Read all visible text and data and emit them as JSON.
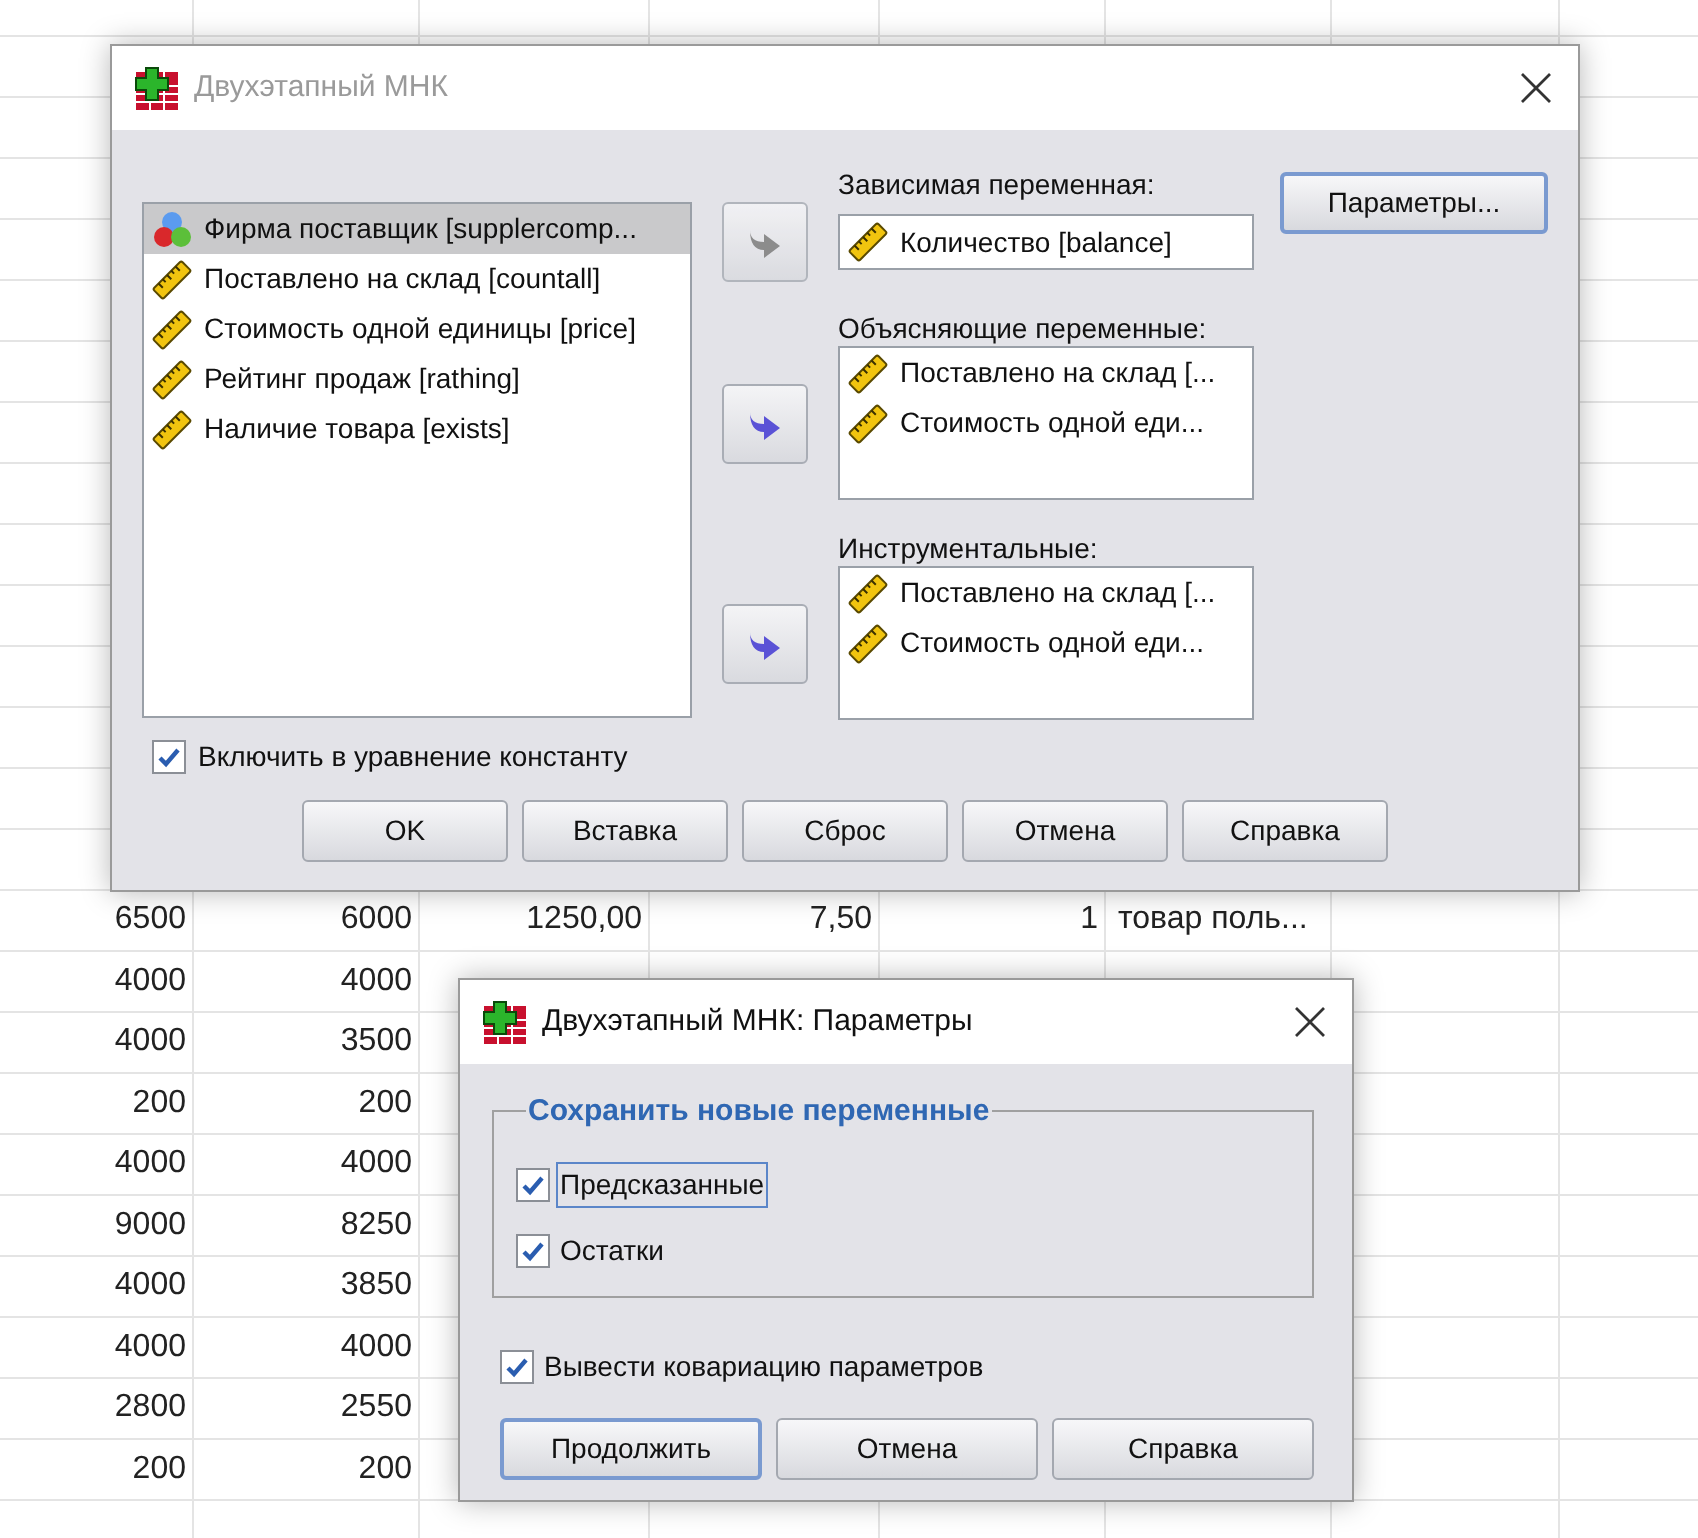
{
  "spreadsheet": {
    "rows": [
      {
        "cells": [
          "6500",
          "6000",
          "1250,00",
          "7,50",
          "1",
          "товар поль..."
        ]
      },
      {
        "cells": [
          "4000",
          "4000"
        ]
      },
      {
        "cells": [
          "4000",
          "3500"
        ]
      },
      {
        "cells": [
          "200",
          "200"
        ]
      },
      {
        "cells": [
          "4000",
          "4000"
        ]
      },
      {
        "cells": [
          "9000",
          "8250"
        ]
      },
      {
        "cells": [
          "4000",
          "3850"
        ]
      },
      {
        "cells": [
          "4000",
          "4000"
        ]
      },
      {
        "cells": [
          "2800",
          "2550"
        ]
      },
      {
        "cells": [
          "200",
          "200"
        ]
      }
    ]
  },
  "main_dialog": {
    "title": "Двухэтапный МНК",
    "active": false,
    "source_list": [
      {
        "label": "Фирма поставщик [supplercomp...",
        "kind": "nominal",
        "selected": true
      },
      {
        "label": "Поставлено на склад [countall]",
        "kind": "scale",
        "selected": false
      },
      {
        "label": "Стоимость одной единицы [price]",
        "kind": "scale",
        "selected": false
      },
      {
        "label": "Рейтинг продаж [rathing]",
        "kind": "scale",
        "selected": false
      },
      {
        "label": "Наличие товара [exists]",
        "kind": "scale",
        "selected": false
      }
    ],
    "targets": [
      {
        "label": "Зависимая переменная:",
        "kind": "field",
        "arrow_disabled": true,
        "items": [
          {
            "label": "Количество [balance]",
            "kind": "scale"
          }
        ]
      },
      {
        "label": "Объясняющие переменные:",
        "kind": "list",
        "arrow_disabled": false,
        "items": [
          {
            "label": "Поставлено на склад [...",
            "kind": "scale"
          },
          {
            "label": "Стоимость одной еди...",
            "kind": "scale"
          }
        ]
      },
      {
        "label": "Инструментальные:",
        "kind": "list",
        "arrow_disabled": false,
        "items": [
          {
            "label": "Поставлено на склад [...",
            "kind": "scale"
          },
          {
            "label": "Стоимость одной еди...",
            "kind": "scale"
          }
        ]
      }
    ],
    "options_button": {
      "label": "Параметры...",
      "focused": true
    },
    "include_constant": {
      "label": "Включить в уравнение константу",
      "checked": true
    },
    "buttons": [
      {
        "label": "OK"
      },
      {
        "label": "Вставка"
      },
      {
        "label": "Сброс"
      },
      {
        "label": "Отмена"
      },
      {
        "label": "Справка"
      }
    ]
  },
  "params_dialog": {
    "title": "Двухэтапный МНК: Параметры",
    "active": true,
    "group": {
      "legend": "Сохранить новые переменные",
      "options": [
        {
          "label": "Предсказанные",
          "checked": true,
          "focused": true
        },
        {
          "label": "Остатки",
          "checked": true,
          "focused": false
        }
      ]
    },
    "covariance": {
      "label": "Вывести ковариацию параметров",
      "checked": true
    },
    "buttons": [
      {
        "label": "Продолжить",
        "default": true
      },
      {
        "label": "Отмена",
        "default": false
      },
      {
        "label": "Справка",
        "default": false
      }
    ]
  }
}
